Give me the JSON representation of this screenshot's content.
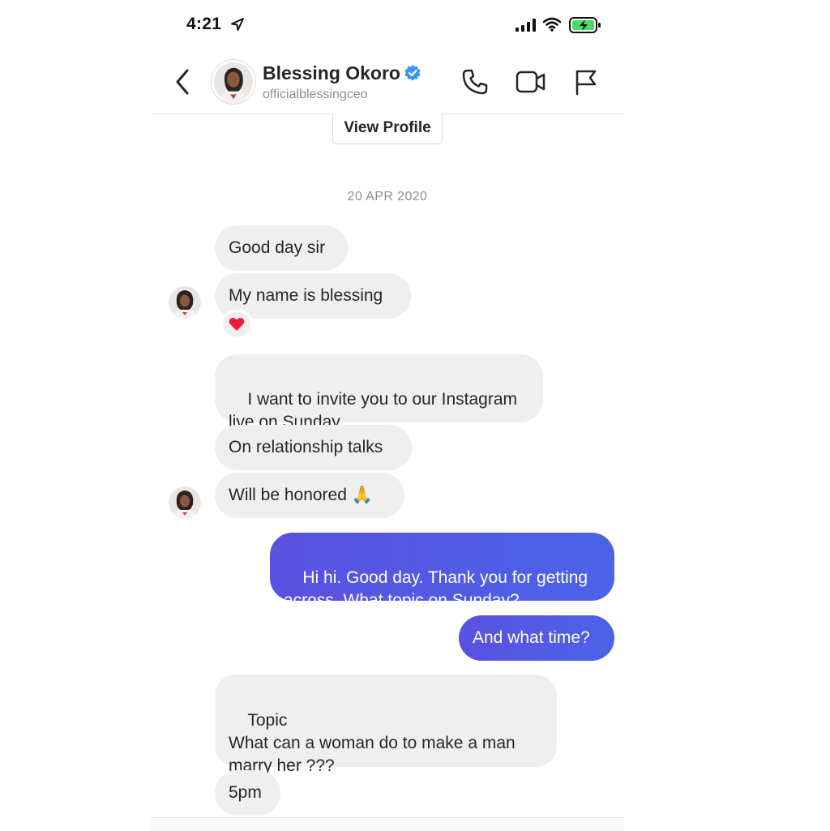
{
  "status_bar": {
    "time": "4:21",
    "icons": [
      "location-arrow-icon",
      "cellular-signal-icon",
      "wifi-icon",
      "battery-charging-icon"
    ]
  },
  "header": {
    "name": "Blessing Okoro",
    "handle": "officialblessingceo",
    "icons": [
      "back-chevron-icon",
      "verified-badge-icon",
      "phone-call-icon",
      "video-call-icon",
      "flag-report-icon"
    ],
    "verified_color": "#3897f0"
  },
  "view_profile_label": "View Profile",
  "date_label": "20 APR 2020",
  "messages": [
    {
      "direction": "incoming",
      "text": "Good day sir"
    },
    {
      "direction": "incoming",
      "text": "My name is blessing",
      "reaction": "heart-reaction-icon"
    },
    {
      "direction": "incoming",
      "text": "I want to invite you to our Instagram\nlive on Sunday"
    },
    {
      "direction": "incoming",
      "text": "On relationship talks"
    },
    {
      "direction": "incoming",
      "text": "Will be honored 🙏"
    },
    {
      "direction": "outgoing",
      "text": "Hi hi. Good day. Thank you for getting\nacross. What topic on Sunday?"
    },
    {
      "direction": "outgoing",
      "text": "And what time?"
    },
    {
      "direction": "incoming",
      "text": "Topic\nWhat can a woman do to make a man\nmarry her ???"
    },
    {
      "direction": "incoming",
      "text": "5pm"
    }
  ],
  "colors": {
    "incoming_bubble": "#efefef",
    "outgoing_bubble_start": "#5a51e0",
    "outgoing_bubble_end": "#4a63e8",
    "secondary_text": "#8e8e8e"
  }
}
